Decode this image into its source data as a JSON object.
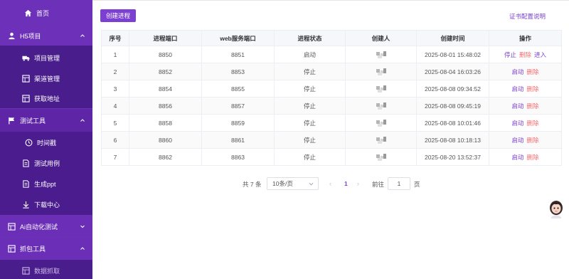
{
  "sidebar": {
    "home": "首页",
    "groups": [
      {
        "label": "H5项目",
        "items": [
          "项目管理",
          "渠道管理",
          "获取地址"
        ]
      },
      {
        "label": "测试工具",
        "items": [
          "时间戳",
          "测试用例",
          "生成ppt",
          "下载中心"
        ]
      },
      {
        "label": "Ai自动化测试",
        "items": []
      },
      {
        "label": "抓包工具",
        "items": [
          "数据抓取"
        ]
      }
    ]
  },
  "toolbar": {
    "create_label": "创建进程",
    "cert_link": "证书配置说明"
  },
  "table": {
    "headers": [
      "序号",
      "进程端口",
      "web服务端口",
      "进程状态",
      "创建人",
      "创建时间",
      "操作"
    ],
    "rows": [
      {
        "idx": "1",
        "port": "8850",
        "web": "8851",
        "status": "启动",
        "time": "2025-08-01 15:48:02",
        "ops": [
          "停止",
          "删除",
          "进入"
        ]
      },
      {
        "idx": "2",
        "port": "8852",
        "web": "8853",
        "status": "停止",
        "time": "2025-08-04 16:03:26",
        "ops": [
          "启动",
          "删除"
        ]
      },
      {
        "idx": "3",
        "port": "8854",
        "web": "8855",
        "status": "停止",
        "time": "2025-08-08 09:34:52",
        "ops": [
          "启动",
          "删除"
        ]
      },
      {
        "idx": "4",
        "port": "8856",
        "web": "8857",
        "status": "停止",
        "time": "2025-08-08 09:45:19",
        "ops": [
          "启动",
          "删除"
        ]
      },
      {
        "idx": "5",
        "port": "8858",
        "web": "8859",
        "status": "停止",
        "time": "2025-08-08 10:01:46",
        "ops": [
          "启动",
          "删除"
        ]
      },
      {
        "idx": "6",
        "port": "8860",
        "web": "8861",
        "status": "停止",
        "time": "2025-08-08 10:18:13",
        "ops": [
          "启动",
          "删除"
        ]
      },
      {
        "idx": "7",
        "port": "8862",
        "web": "8863",
        "status": "停止",
        "time": "2025-08-20 13:52:37",
        "ops": [
          "启动",
          "删除"
        ]
      }
    ]
  },
  "pagination": {
    "total": "共 7 条",
    "page_size": "10条/页",
    "current": "1",
    "goto": "前往",
    "goto_value": "1",
    "page_suffix": "页"
  },
  "colors": {
    "sidebar": "#6c31b8",
    "sidebar_sub": "#4a1d8c",
    "accent": "#7b3fd1",
    "danger": "#f56c6c"
  }
}
